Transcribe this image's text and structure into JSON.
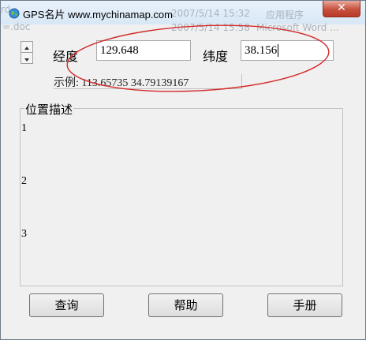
{
  "window": {
    "title": "GPS名片 www.mychinamap.com",
    "close_glyph": "✕"
  },
  "background_ghost": {
    "row1_left": "rd",
    "row1_date": "2007/5/14 15:32",
    "row1_type": "应用程序",
    "row2_left": "=.doc",
    "row2_date": "2007/5/14 15:58",
    "row2_type": "Microsoft Word ..."
  },
  "form": {
    "longitude_label": "经度",
    "longitude_value": "129.648",
    "latitude_label": "纬度",
    "latitude_value": "38.156",
    "example_text": "示例: 113.65735    34.79139167",
    "spin_up_glyph": "▲",
    "spin_down_glyph": "▼"
  },
  "description": {
    "group_title": "位置描述",
    "lines": [
      "1",
      "2",
      "3"
    ]
  },
  "buttons": {
    "query": "查询",
    "help": "帮助",
    "manual": "手册"
  },
  "colors": {
    "annotation_ellipse": "#d42a2a",
    "close_button": "#c7503e"
  }
}
